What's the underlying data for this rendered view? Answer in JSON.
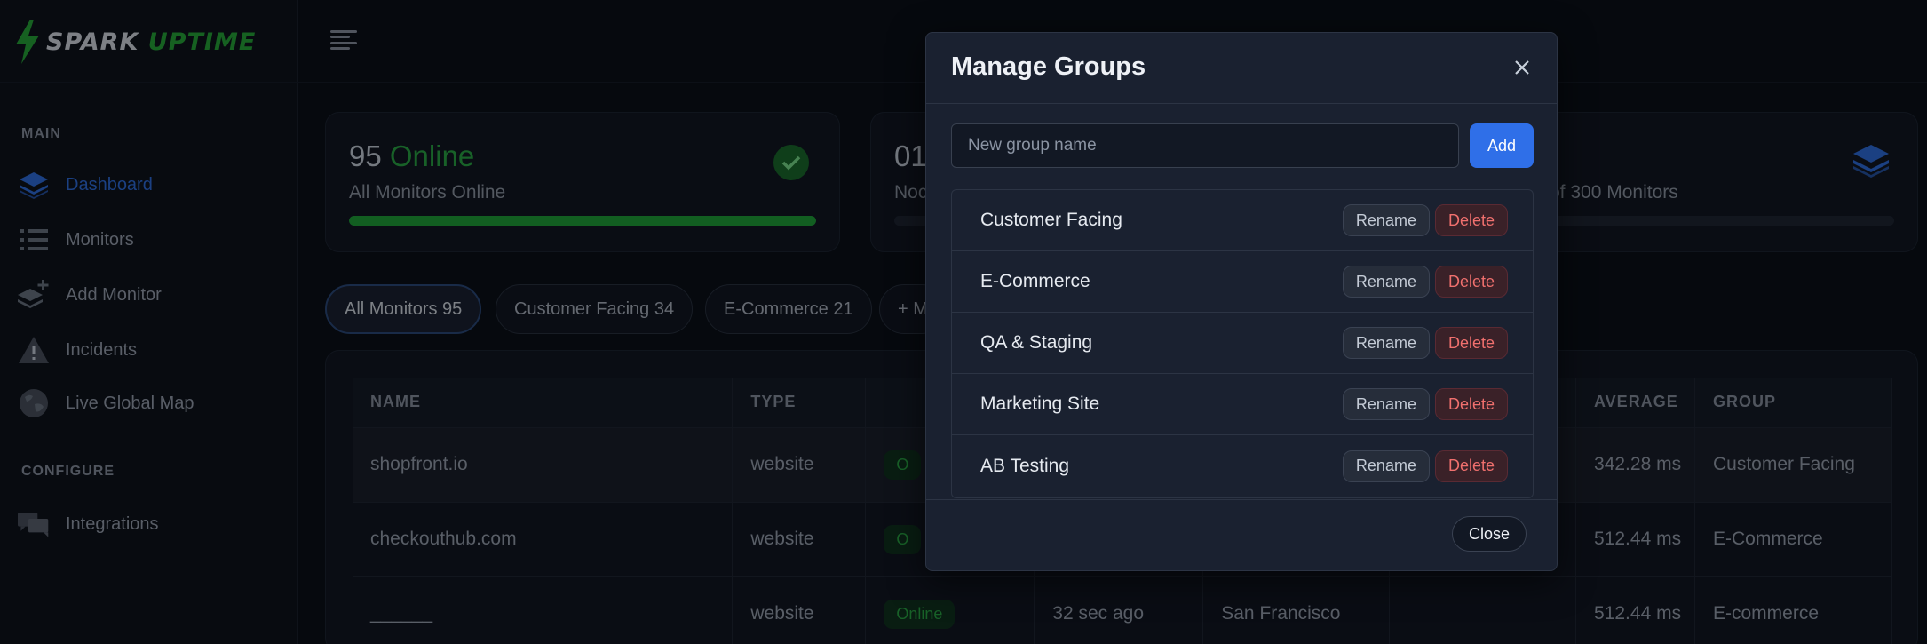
{
  "brand": {
    "spark": "SPARK",
    "uptime": "UPTIME"
  },
  "sidebar": {
    "sections": [
      {
        "label": "MAIN"
      },
      {
        "label": "CONFIGURE"
      }
    ],
    "items": [
      {
        "label": "Dashboard",
        "icon": "layers-icon",
        "active": true
      },
      {
        "label": "Monitors",
        "icon": "list-icon"
      },
      {
        "label": "Add Monitor",
        "icon": "add-stack-icon"
      },
      {
        "label": "Incidents",
        "icon": "warning-icon"
      },
      {
        "label": "Live Global Map",
        "icon": "globe-icon"
      },
      {
        "label": "Integrations",
        "icon": "chat-icon"
      }
    ]
  },
  "stats": [
    {
      "count": "95",
      "word": "Online",
      "sub": "All Monitors Online",
      "progress": 1.0,
      "color": "#20a33a"
    },
    {
      "count": "01",
      "sub": "Noc"
    },
    {
      "sub": "of 300 Monitors",
      "progress": 0.07,
      "color": "#2f6fe0"
    }
  ],
  "filter_chips": [
    {
      "label": "All Monitors 95",
      "active": true
    },
    {
      "label": "Customer Facing 34"
    },
    {
      "label": "E-Commerce 21"
    },
    {
      "label": "+ M"
    }
  ],
  "table": {
    "columns": [
      "NAME",
      "TYPE",
      "",
      "",
      "",
      "",
      "AVERAGE",
      "GROUP"
    ],
    "rows": [
      {
        "name": "shopfront.io",
        "type": "website",
        "status": "O",
        "last": "",
        "location": "",
        "extra": "",
        "average": "342.28 ms",
        "group": "Customer Facing"
      },
      {
        "name": "checkouthub.com",
        "type": "website",
        "status": "O",
        "last": "",
        "location": "",
        "extra": "",
        "average": "512.44 ms",
        "group": "E-Commerce"
      },
      {
        "name": "______",
        "type": "website",
        "status": "Online",
        "last": "32 sec ago",
        "location": "San Francisco",
        "extra": "",
        "average": "512.44 ms",
        "group": "E-commerce"
      }
    ]
  },
  "modal": {
    "title": "Manage Groups",
    "input_placeholder": "New group name",
    "input_value": "",
    "add_label": "Add",
    "rename_label": "Rename",
    "delete_label": "Delete",
    "close_label": "Close",
    "groups": [
      {
        "name": "Customer Facing"
      },
      {
        "name": "E-Commerce"
      },
      {
        "name": "QA & Staging"
      },
      {
        "name": "Marketing Site"
      },
      {
        "name": "AB Testing"
      }
    ]
  }
}
